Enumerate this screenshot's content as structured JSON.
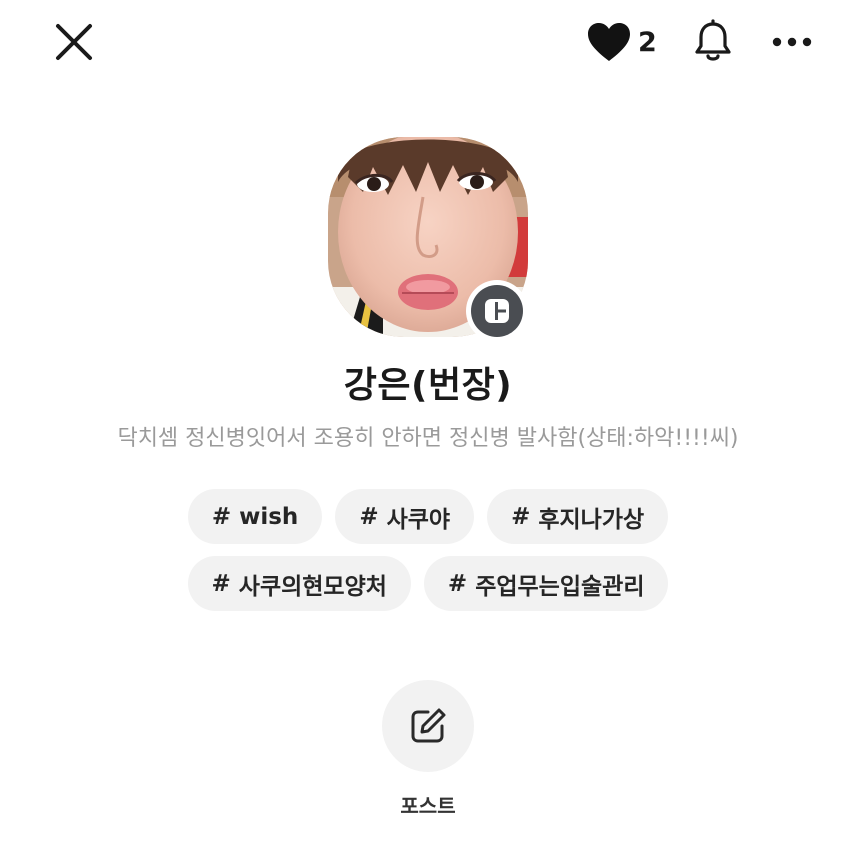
{
  "header": {
    "like_count": "2",
    "icons": [
      "close-icon",
      "heart-icon",
      "bell-icon",
      "more-icon"
    ]
  },
  "profile": {
    "name": "강은(번장)",
    "bio": "닥치셈 정신병잇어서 조용히 안하면 정신병 발사함(상태:하악!!!!씨)",
    "avatar_badge_icon": "layout-icon"
  },
  "tags": [
    {
      "hash": "#",
      "label": "wish"
    },
    {
      "hash": "#",
      "label": "사쿠야"
    },
    {
      "hash": "#",
      "label": "후지나가상"
    },
    {
      "hash": "#",
      "label": "사쿠의현모양처"
    },
    {
      "hash": "#",
      "label": "주업무는입술관리"
    }
  ],
  "actions": {
    "post_label": "포스트",
    "post_icon": "edit-icon"
  },
  "colors": {
    "text_primary": "#1a1a1a",
    "text_secondary": "#9a9a9a",
    "chip_bg": "#f2f2f2",
    "badge_bg": "#4a4d52"
  }
}
